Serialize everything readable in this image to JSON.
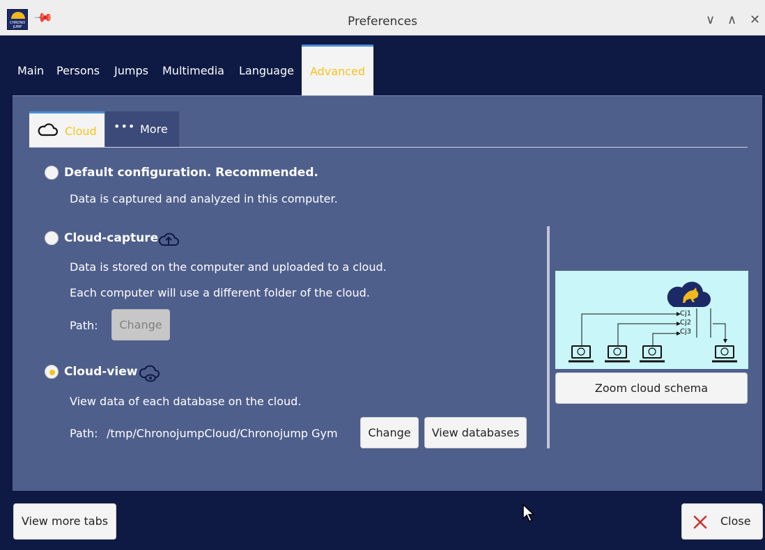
{
  "window": {
    "title": "Preferences",
    "logo_text": "CHRONO JUMP",
    "controls": [
      "∨",
      "∧",
      "✕"
    ]
  },
  "tabs": [
    {
      "label": "Main",
      "active": false
    },
    {
      "label": "Persons",
      "active": false
    },
    {
      "label": "Jumps",
      "active": false
    },
    {
      "label": "Multimedia",
      "active": false
    },
    {
      "label": "Language",
      "active": false
    },
    {
      "label": "Advanced",
      "active": true
    }
  ],
  "subtabs": [
    {
      "label": "Cloud",
      "icon": "cloud-icon",
      "active": true
    },
    {
      "label": "More",
      "icon": "dots-icon",
      "active": false
    }
  ],
  "options": {
    "default": {
      "title": "Default configuration.   Recommended.",
      "desc": "Data is captured and analyzed in this computer.",
      "selected": false
    },
    "capture": {
      "title": "Cloud-capture",
      "desc1": "Data is stored on the computer and uploaded to a cloud.",
      "desc2": "Each computer will use a different folder of the cloud.",
      "path_label": "Path:",
      "change_label": "Change",
      "selected": false
    },
    "view": {
      "title": "Cloud-view",
      "desc": "View data of each database on the cloud.",
      "path_label": "Path:",
      "path_value": "/tmp/ChronojumpCloud/Chronojump Gym",
      "change_label": "Change",
      "view_db_label": "View databases",
      "selected": true
    }
  },
  "schema": {
    "labels": [
      "Cj1",
      "Cj2",
      "Cj3"
    ],
    "zoom_label": "Zoom cloud schema"
  },
  "footer": {
    "more_tabs_label": "View more tabs",
    "close_label": "Close"
  },
  "colors": {
    "window_bg": "#0e1a44",
    "panel_bg": "#4f5f8c",
    "accent_yellow": "#f5c518",
    "tab_indicator": "#4a90d9",
    "close_x": "#d0302f"
  }
}
